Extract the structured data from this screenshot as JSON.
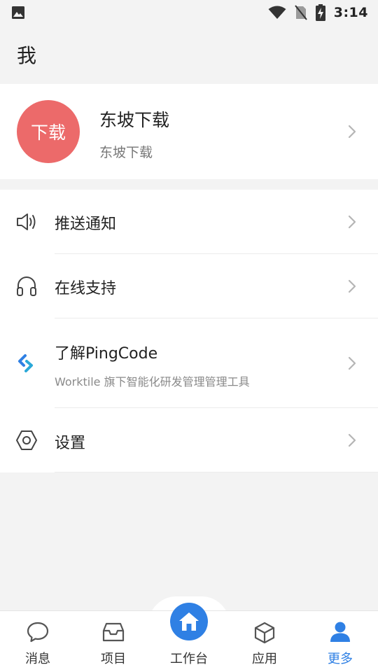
{
  "status_bar": {
    "time": "3:14",
    "icons": [
      "image-icon",
      "wifi-icon",
      "no-sim-icon",
      "battery-charging-icon"
    ]
  },
  "header": {
    "title": "我"
  },
  "profile": {
    "avatar_text": "下载",
    "avatar_color": "#ec6a6a",
    "name": "东坡下载",
    "subtitle": "东坡下载"
  },
  "menu": {
    "items": [
      {
        "label": "推送通知",
        "icon": "speaker-icon"
      },
      {
        "label": "在线支持",
        "icon": "headphones-icon"
      },
      {
        "label": "了解PingCode",
        "subtitle": "Worktile 旗下智能化研发管理管理工具",
        "icon": "pingcode-logo-icon"
      },
      {
        "label": "设置",
        "icon": "settings-hexagon-icon"
      }
    ]
  },
  "tabbar": {
    "accent": "#2f80e4",
    "tabs": [
      {
        "label": "消息",
        "icon": "chat-bubble-icon"
      },
      {
        "label": "项目",
        "icon": "inbox-icon"
      },
      {
        "label": "工作台",
        "icon": "home-icon"
      },
      {
        "label": "应用",
        "icon": "cube-icon"
      },
      {
        "label": "更多",
        "icon": "user-icon",
        "active": true
      }
    ]
  }
}
